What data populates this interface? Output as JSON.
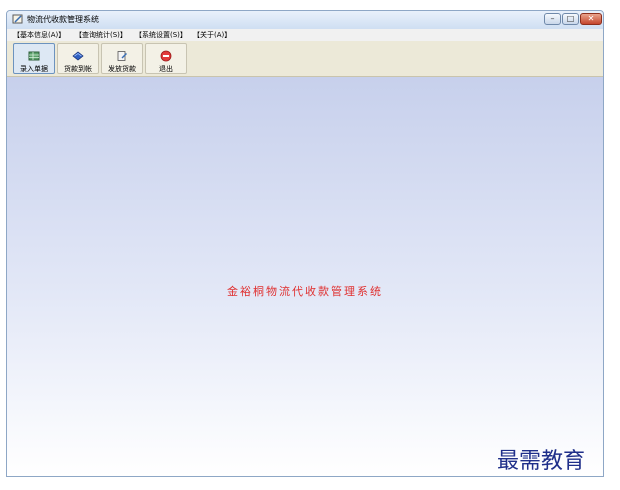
{
  "window": {
    "title": "物流代收款管理系统",
    "buttons": {
      "minimize": "–",
      "maximize": "□",
      "close": "✕"
    }
  },
  "menu": [
    {
      "label": "【基本信息(A)】"
    },
    {
      "label": "【查询统计(S)】"
    },
    {
      "label": "【系统设置(S)】"
    },
    {
      "label": "【关于(A)】"
    }
  ],
  "toolbar": [
    {
      "label": "录入单据",
      "icon": "table-icon"
    },
    {
      "label": "货款到帐",
      "icon": "book-icon"
    },
    {
      "label": "发放货款",
      "icon": "edit-document-icon"
    },
    {
      "label": "退出",
      "icon": "stop-icon"
    }
  ],
  "main": {
    "center_text": "金裕桐物流代收款管理系统"
  },
  "watermark": "最需教育",
  "colors": {
    "center_text": "#e03030",
    "watermark": "#1f2f8a"
  }
}
